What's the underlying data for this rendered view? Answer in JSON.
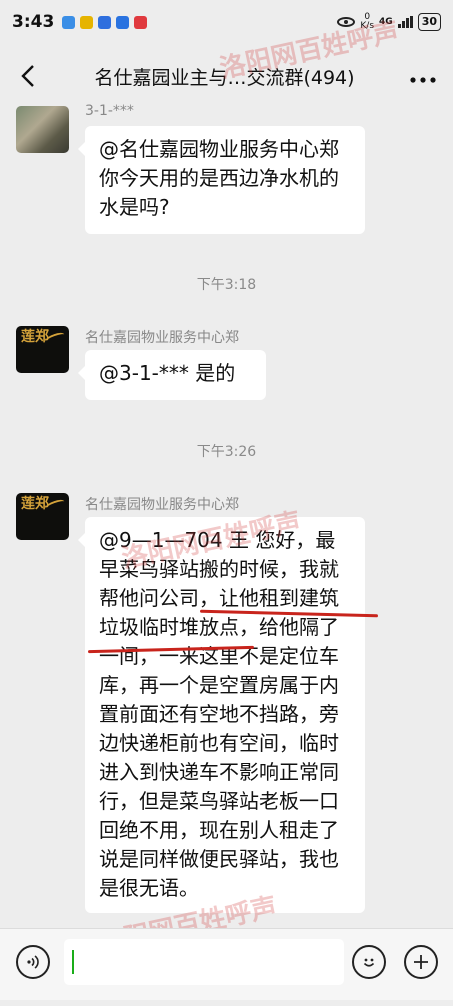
{
  "status_bar": {
    "time": "3:43",
    "net_speed": "0",
    "net_unit": "K/s",
    "network": "4G",
    "battery": "30"
  },
  "header": {
    "title": "名仕嘉园业主与…交流群(494)",
    "back_icon": "chevron-left-icon",
    "more_icon": "more-dots-icon"
  },
  "messages": [
    {
      "sender": "3-1-***",
      "text": "@名仕嘉园物业服务中心郑你今天用的是西边净水机的水是吗?"
    },
    {
      "time": "下午3:18"
    },
    {
      "sender": "名仕嘉园物业服务中心郑",
      "text": "@3-1-*** 是的"
    },
    {
      "time": "下午3:26"
    },
    {
      "sender": "名仕嘉园物业服务中心郑",
      "text": "@9—1—704 王  您好，最早菜鸟驿站搬的时候，我就帮他问公司，让他租到建筑垃圾临时堆放点，给他隔了一间，一来这里不是定位车库，再一个是空置房属于内置前面还有空地不挡路，旁边快递柜前也有空间，临时进入到快递车不影响正常同行，但是菜鸟驿站老板一口回绝不用，现在别人租走了说是同样做便民驿站，我也是很无语。"
    }
  ],
  "avatar_text": "莲郑",
  "input_bar": {
    "voice_icon": "voice-icon",
    "emoji_icon": "emoji-icon",
    "plus_icon": "plus-icon"
  },
  "watermark": {
    "text_1": "洛阳网",
    "text_2": "百姓呼声"
  },
  "colors": {
    "background": "#ededed",
    "bubble": "#ffffff",
    "highlight_underline": "#c8241c",
    "cursor": "#1aad19"
  }
}
